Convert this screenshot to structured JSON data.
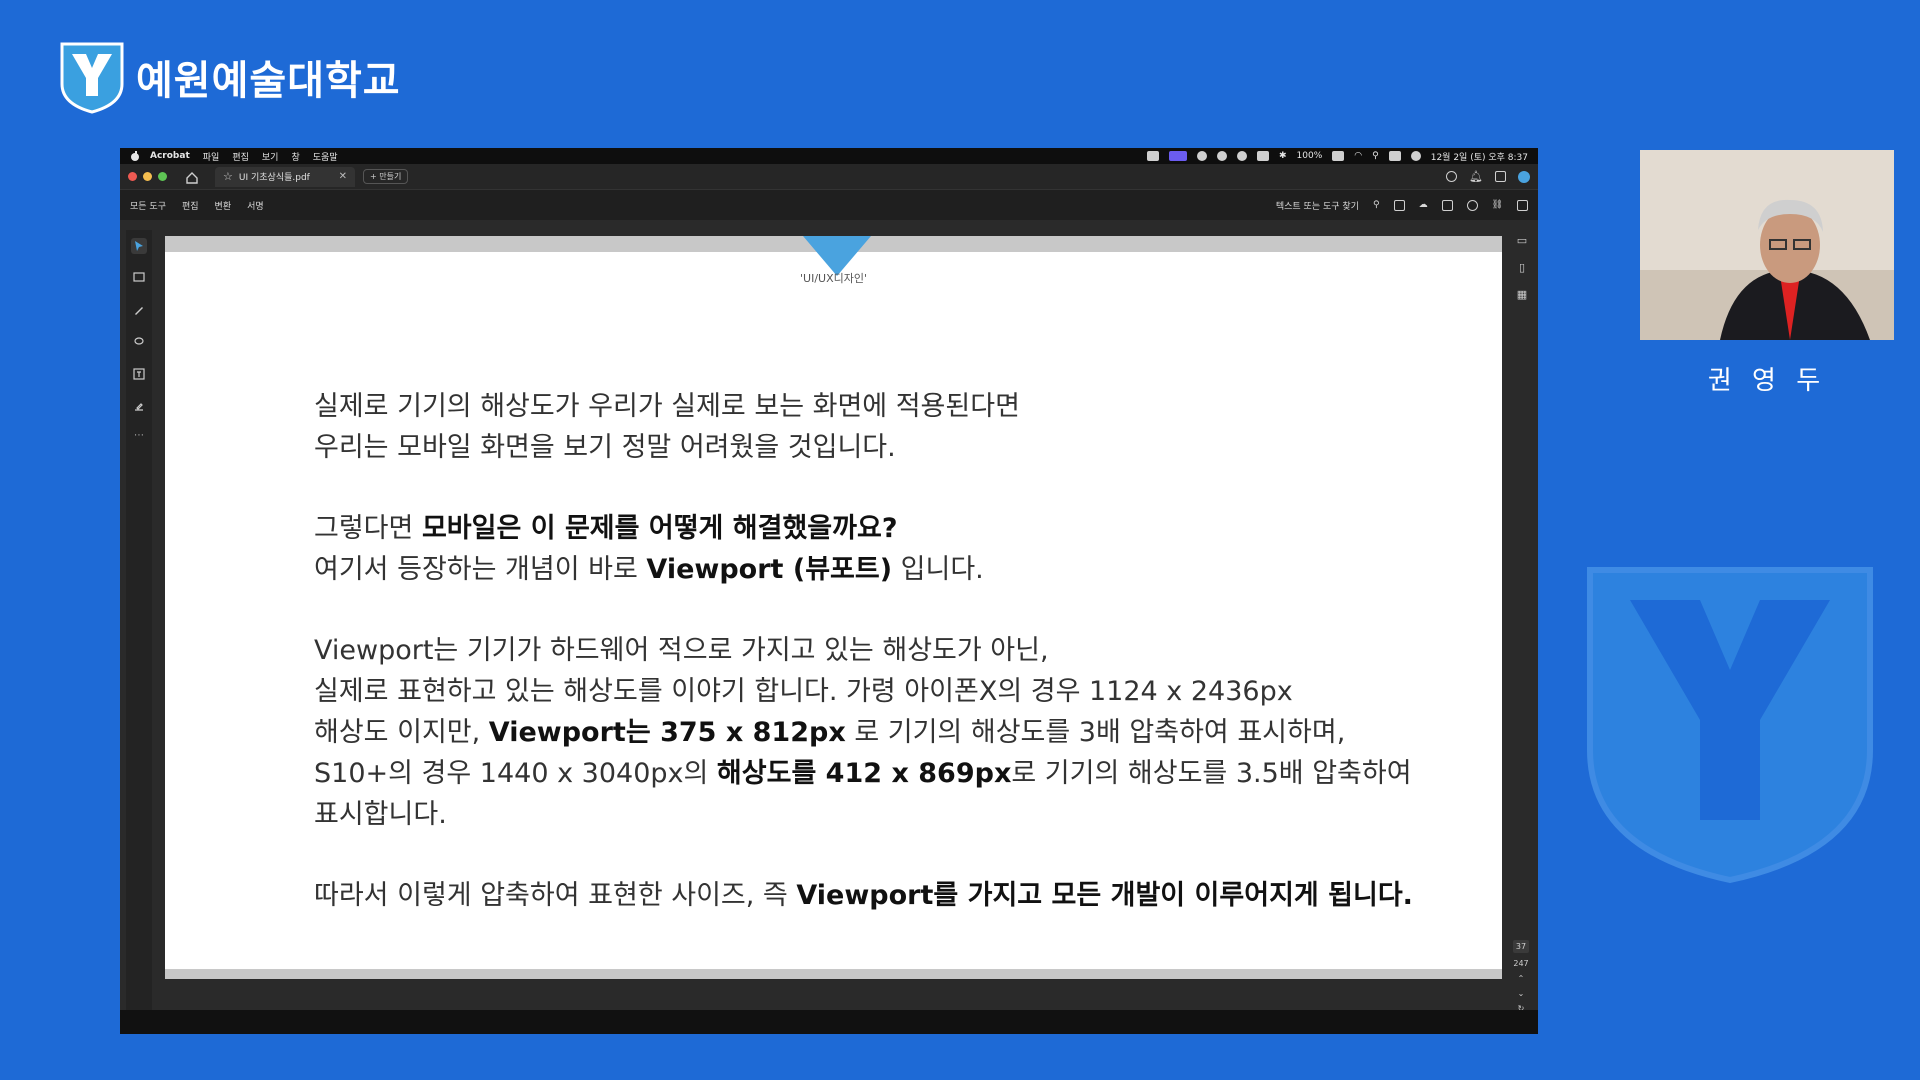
{
  "header": {
    "university_name": "예원예술대학교"
  },
  "mac_menubar": {
    "items": [
      "Acrobat",
      "파일",
      "편집",
      "보기",
      "창",
      "도움말"
    ],
    "battery": "100%",
    "datetime": "12월 2일 (토) 오후 8:37"
  },
  "tabbar": {
    "document_tab": "UI 기초상식들.pdf",
    "new_tab_label": "+ 만들기"
  },
  "toolbar": {
    "menus": [
      "모든 도구",
      "편집",
      "변환",
      "서명"
    ],
    "search_label": "텍스트 또는 도구 찾기"
  },
  "document": {
    "caption": "'UI/UX디자인'",
    "p1_l1": "실제로 기기의 해상도가 우리가 실제로 보는 화면에 적용된다면",
    "p1_l2": "우리는 모바일 화면을 보기 정말 어려웠을 것입니다.",
    "p2_l1_a": "그렇다면 ",
    "p2_l1_b": "모바일은 이 문제를 어떻게 해결했을까요?",
    "p2_l2_a": "여기서 등장하는 개념이 바로 ",
    "p2_l2_b": "Viewport (뷰포트)",
    "p2_l2_c": " 입니다.",
    "p3_l1": "Viewport는 기기가 하드웨어 적으로 가지고 있는 해상도가 아닌,",
    "p3_l2": "실제로 표현하고 있는 해상도를 이야기 합니다. 가령 아이폰X의 경우 1124 x 2436px",
    "p3_l3_a": "해상도 이지만, ",
    "p3_l3_b": "Viewport는 375 x 812px",
    "p3_l3_c": " 로 기기의 해상도를 3배 압축하여 표시하며,",
    "p3_l4_a": "S10+의 경우 1440 x 3040px의 ",
    "p3_l4_b": "해상도를 412 x 869px",
    "p3_l4_c": "로 기기의 해상도를 3.5배 압축하여",
    "p3_l5": "표시합니다.",
    "p4_a": "따라서 이렇게 압축하여 표현한 사이즈, 즉 ",
    "p4_b": "Viewport를 가지고 모든 개발이 이루어지게 됩니다."
  },
  "page_indicator": {
    "current": "37",
    "total": "247"
  },
  "presenter": {
    "name": "권 영 두"
  },
  "colors": {
    "background": "#1e6ad6",
    "accent": "#4aa3df"
  }
}
